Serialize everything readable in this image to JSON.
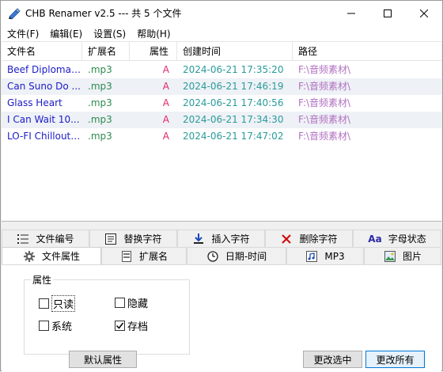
{
  "window": {
    "title": "CHB Renamer v2.5 --- 共 5 个文件"
  },
  "menu": [
    {
      "label": "文件(F)"
    },
    {
      "label": "编辑(E)"
    },
    {
      "label": "设置(S)"
    },
    {
      "label": "帮助(H)"
    }
  ],
  "table": {
    "columns": [
      "文件名",
      "扩展名",
      "属性",
      "创建时间",
      "路径"
    ],
    "rows": [
      [
        "Beef Diplomat...",
        ".mp3",
        "A",
        "2024-06-21 17:35:20",
        "F:\\音频素材\\"
      ],
      [
        "Can Suno Do ...",
        ".mp3",
        "A",
        "2024-06-21 17:46:19",
        "F:\\音频素材\\"
      ],
      [
        "Glass Heart",
        ".mp3",
        "A",
        "2024-06-21 17:40:56",
        "F:\\音频素材\\"
      ],
      [
        "I Can Wait 10...",
        ".mp3",
        "A",
        "2024-06-21 17:34:30",
        "F:\\音频素材\\"
      ],
      [
        "LO-FI Chillout ...",
        ".mp3",
        "A",
        "2024-06-21 17:47:02",
        "F:\\音频素材\\"
      ]
    ]
  },
  "tabs_row1": [
    {
      "label": "文件编号",
      "icon": "list-number-icon"
    },
    {
      "label": "替换字符",
      "icon": "replace-icon"
    },
    {
      "label": "插入字符",
      "icon": "insert-icon"
    },
    {
      "label": "删除字符",
      "icon": "delete-icon"
    },
    {
      "label": "字母状态",
      "icon": "letter-case-icon"
    }
  ],
  "tabs_row2": [
    {
      "label": "文件属性",
      "icon": "gear-icon",
      "active": true
    },
    {
      "label": "扩展名",
      "icon": "extension-icon"
    },
    {
      "label": "日期-时间",
      "icon": "clock-icon"
    },
    {
      "label": "MP3",
      "icon": "mp3-icon"
    },
    {
      "label": "图片",
      "icon": "picture-icon"
    }
  ],
  "attributes": {
    "legend": "属性",
    "readonly": {
      "label": "只读",
      "checked": false
    },
    "hidden": {
      "label": "隐藏",
      "checked": false
    },
    "system": {
      "label": "系统",
      "checked": false
    },
    "archive": {
      "label": "存档",
      "checked": true
    }
  },
  "buttons": {
    "default_attr": "默认属性",
    "change_selected": "更改选中",
    "change_all": "更改所有"
  },
  "colors": {
    "filename": "#1b1bc8",
    "extension": "#2d8a4f",
    "attr": "#e0266e",
    "created": "#2a9b9b",
    "path": "#b070c0",
    "row_alt": "#eef1f6",
    "accent": "#0078d7"
  }
}
